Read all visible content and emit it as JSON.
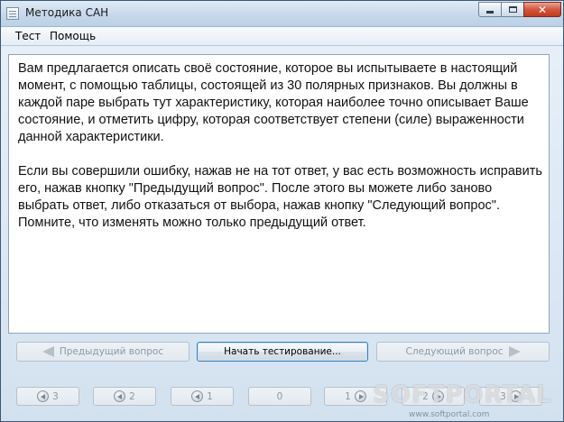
{
  "window": {
    "title": "Методика САН"
  },
  "menu": {
    "items": [
      "Тест",
      "Помощь"
    ]
  },
  "instructions": {
    "paragraph1": "Вам предлагается описать своё состояние, которое вы испытываете в настоящий момент, с помощью таблицы, состоящей из 30 полярных признаков. Вы должны в каждой паре выбрать тут характеристику, которая наиболее точно описывает Ваше состояние, и отметить цифру, которая соответствует степени (силе) выраженности данной характеристики.",
    "paragraph2": "Если вы совершили ошибку, нажав не на тот ответ, у вас есть возможность исправить его, нажав кнопку \"Предыдущий вопрос\". После этого вы можете либо заново выбрать ответ, либо отказаться от выбора, нажав кнопку \"Следующий вопрос\". Помните, что изменять можно только предыдущий ответ."
  },
  "nav": {
    "prev_label": "Предыдущий вопрос",
    "start_label": "Начать тестирование...",
    "next_label": "Следующий вопрос"
  },
  "scale": {
    "values": [
      "3",
      "2",
      "1",
      "0",
      "1",
      "2",
      "3"
    ]
  },
  "watermark": {
    "main": "SOFTPORTAL",
    "url": "www.softportal.com"
  }
}
